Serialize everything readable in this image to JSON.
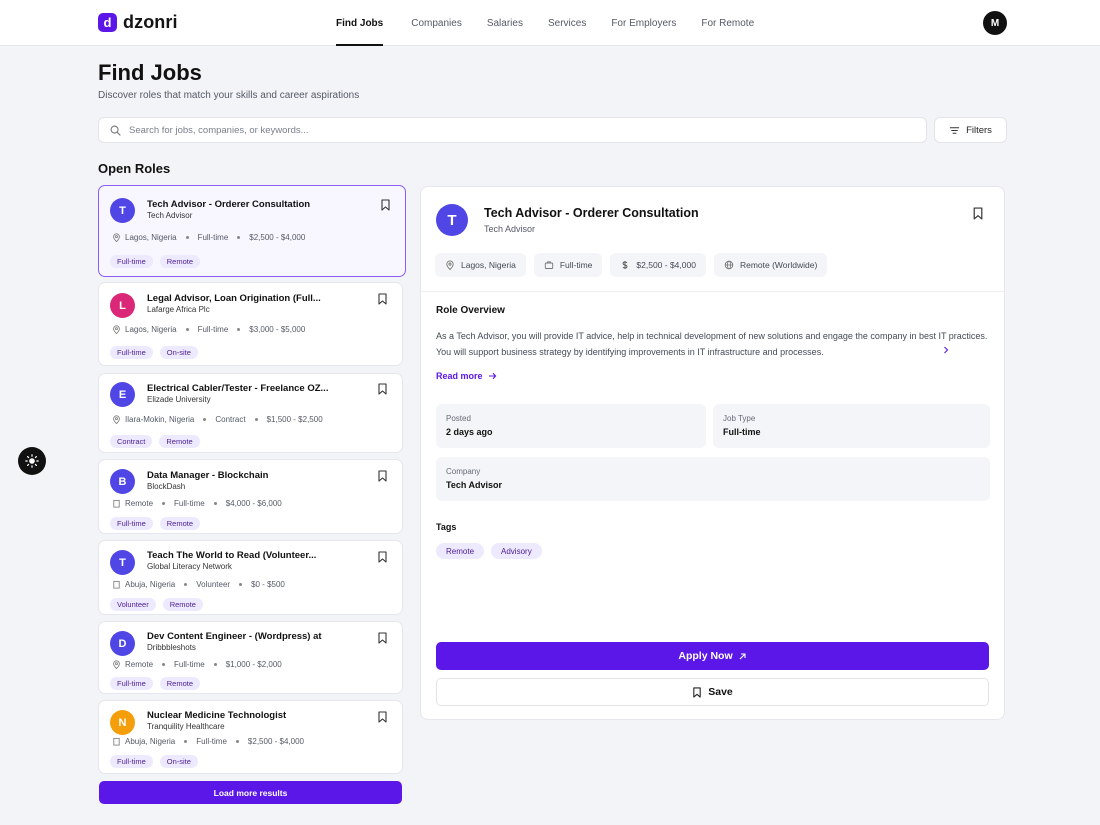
{
  "brand": {
    "logo_letter": "d",
    "name": "dzonri"
  },
  "nav": {
    "items": [
      "Find Jobs",
      "Companies",
      "Salaries",
      "Services",
      "For Employers",
      "For Remote"
    ],
    "active": "Find Jobs"
  },
  "user": {
    "initial": "M"
  },
  "header": {
    "title": "Find Jobs",
    "subtitle": "Discover roles that match your skills and career aspirations"
  },
  "search": {
    "placeholder": "Search for jobs, companies, or keywords...",
    "filters_label": "Filters"
  },
  "list": {
    "title": "Open Roles",
    "load_more_label": "Load more results",
    "jobs": [
      {
        "initial": "T",
        "avatar_color": "#4f46e5",
        "title": "Tech Advisor - Orderer Consultation",
        "company": "Tech Advisor",
        "location": "Lagos, Nigeria",
        "location_icon": "pin-icon",
        "type": "Full-time",
        "salary": "$2,500 - $4,000",
        "tags": [
          "Full-time",
          "Remote"
        ],
        "selected": true
      },
      {
        "initial": "L",
        "avatar_color": "#db2777",
        "title": "Legal Advisor, Loan Origination (Full...",
        "company": "Lafarge Africa Plc",
        "location": "Lagos, Nigeria",
        "location_icon": "pin-icon",
        "type": "Full-time",
        "salary": "$3,000 - $5,000",
        "tags": [
          "Full-time",
          "On-site"
        ]
      },
      {
        "initial": "E",
        "avatar_color": "#4f46e5",
        "title": "Electrical Cabler/Tester - Freelance OZ...",
        "company": "Elizade University",
        "location": "Ilara-Mokin, Nigeria",
        "location_icon": "pin-icon",
        "type": "Contract",
        "salary": "$1,500 - $2,500",
        "tags": [
          "Contract",
          "Remote"
        ]
      },
      {
        "initial": "B",
        "avatar_color": "#4f46e5",
        "title": "Data Manager - Blockchain",
        "company": "BlockDash",
        "location": "Remote",
        "location_icon": "building-icon",
        "type": "Full-time",
        "salary": "$4,000 - $6,000",
        "tags": [
          "Full-time",
          "Remote"
        ]
      },
      {
        "initial": "T",
        "avatar_color": "#4f46e5",
        "title": "Teach The World to Read (Volunteer...",
        "company": "Global Literacy Network",
        "location": "Abuja, Nigeria",
        "location_icon": "building-icon",
        "type": "Volunteer",
        "salary": "$0 - $500",
        "tags": [
          "Volunteer",
          "Remote"
        ]
      },
      {
        "initial": "D",
        "avatar_color": "#4f46e5",
        "title": "Dev Content Engineer - (Wordpress) at",
        "company": "Dribbbleshots",
        "location": "Remote",
        "location_icon": "pin-icon",
        "type": "Full-time",
        "salary": "$1,000 - $2,000",
        "tags": [
          "Full-time",
          "Remote"
        ]
      },
      {
        "initial": "N",
        "avatar_color": "#f59e0b",
        "title": "Nuclear Medicine Technologist",
        "company": "Tranquility Healthcare",
        "location": "Abuja, Nigeria",
        "location_icon": "building-icon",
        "type": "Full-time",
        "salary": "$2,500 - $4,000",
        "tags": [
          "Full-time",
          "On-site"
        ]
      }
    ]
  },
  "detail": {
    "initial": "T",
    "title": "Tech Advisor - Orderer Consultation",
    "company": "Tech Advisor",
    "chips": [
      {
        "icon": "pin-icon",
        "label": "Lagos, Nigeria"
      },
      {
        "icon": "briefcase-icon",
        "label": "Full-time"
      },
      {
        "icon": "dollar-icon",
        "label": "$2,500 - $4,000"
      },
      {
        "icon": "globe-icon",
        "label": "Remote (Worldwide)"
      }
    ],
    "overview_title": "Role Overview",
    "overview_text": "As a Tech Advisor, you will provide IT advice, help in technical development of new solutions and engage the company in best IT practices. You will support business strategy by identifying improvements in IT infrastructure and processes.",
    "read_more": "Read more",
    "posted_label": "Posted",
    "posted_value": "2 days ago",
    "job_type_label": "Job Type",
    "job_type_value": "Full-time",
    "company_label": "Company",
    "company_value": "Tech Advisor",
    "tags_title": "Tags",
    "tags": [
      "Remote",
      "Advisory"
    ],
    "apply_label": "Apply Now",
    "save_label": "Save"
  }
}
